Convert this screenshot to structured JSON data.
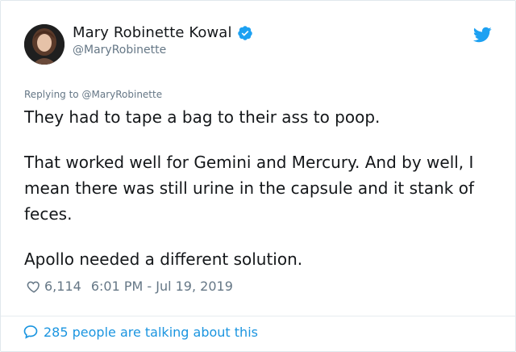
{
  "author": {
    "display_name": "Mary Robinette Kowal",
    "handle": "@MaryRobinette",
    "verified": true,
    "avatar_icon": "user-avatar"
  },
  "reply": {
    "prefix": "Replying to",
    "to_handle": "@MaryRobinette"
  },
  "tweet": {
    "paragraphs": [
      "They had to tape a bag to their ass to poop.",
      "That worked well for Gemini and Mercury. And by well, I mean there was still urine in the capsule and it stank of feces.",
      "Apollo needed a different solution."
    ]
  },
  "meta": {
    "like_count": "6,114",
    "timestamp": "6:01 PM - Jul 19, 2019"
  },
  "footer": {
    "talking_text": "285 people are talking about this"
  },
  "colors": {
    "accent": "#1da1f2",
    "link": "#1b95e0",
    "secondary_text": "#657786",
    "primary_text": "#14171a"
  },
  "icons": {
    "brand": "twitter-bird-icon",
    "verified": "verified-badge-icon",
    "like": "heart-icon",
    "reply": "speech-bubble-icon"
  }
}
